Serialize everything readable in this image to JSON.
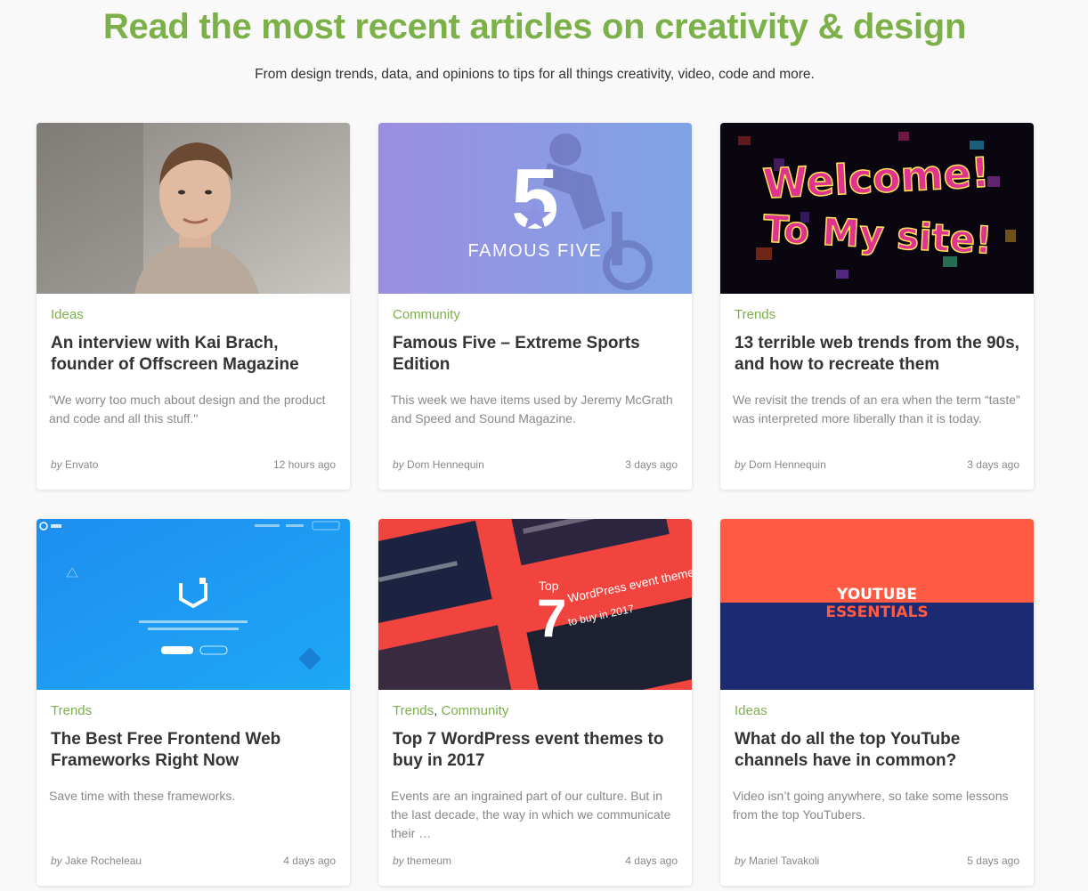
{
  "header": {
    "title": "Read the most recent articles on creativity & design",
    "subtitle": "From design trends, data, and opinions to tips for all things creativity, video, code and more."
  },
  "colors": {
    "accent": "#7cb049",
    "text": "#333333",
    "muted": "#888888"
  },
  "by_label": "by",
  "cards": [
    {
      "categories": [
        "Ideas"
      ],
      "title": "An interview with Kai Brach, founder of Offscreen Magazine",
      "excerpt": "\"We worry too much about design and the product and code and all this stuff.\"",
      "author": "Envato",
      "time": "12 hours ago"
    },
    {
      "categories": [
        "Community"
      ],
      "title": "Famous Five – Extreme Sports Edition",
      "excerpt": "This week we have items used by Jeremy McGrath and Speed and Sound Magazine.",
      "author": "Dom Hennequin",
      "time": "3 days ago",
      "image_text": {
        "number": "5",
        "caption": "FAMOUS FIVE"
      }
    },
    {
      "categories": [
        "Trends"
      ],
      "title": "13 terrible web trends from the 90s, and how to recreate them",
      "excerpt": "We revisit the trends of an era when the term “taste” was interpreted more liberally than it is today.",
      "author": "Dom Hennequin",
      "time": "3 days ago",
      "image_text": {
        "line1": "Welcome!",
        "line2": "To My site!"
      }
    },
    {
      "categories": [
        "Trends"
      ],
      "title": "The Best Free Frontend Web Frameworks Right Now",
      "excerpt": "Save time with these frameworks.",
      "author": "Jake Rocheleau",
      "time": "4 days ago"
    },
    {
      "categories": [
        "Trends",
        "Community"
      ],
      "title": "Top 7 WordPress event themes to buy in 2017",
      "excerpt": "Events are an ingrained part of our culture. But in the last decade, the way in which we communicate their …",
      "author": "themeum",
      "time": "4 days ago",
      "image_text": {
        "top": "Top",
        "number": "7",
        "line1": "WordPress event themes",
        "line2": "to buy in 2017"
      }
    },
    {
      "categories": [
        "Ideas"
      ],
      "title": "What do all the top YouTube channels have in common?",
      "excerpt": "Video isn’t going anywhere, so take some lessons from the top YouTubers.",
      "author": "Mariel Tavakoli",
      "time": "5 days ago",
      "image_text": {
        "line1": "YOUTUBE",
        "line2": "ESSENTIALS"
      }
    }
  ]
}
